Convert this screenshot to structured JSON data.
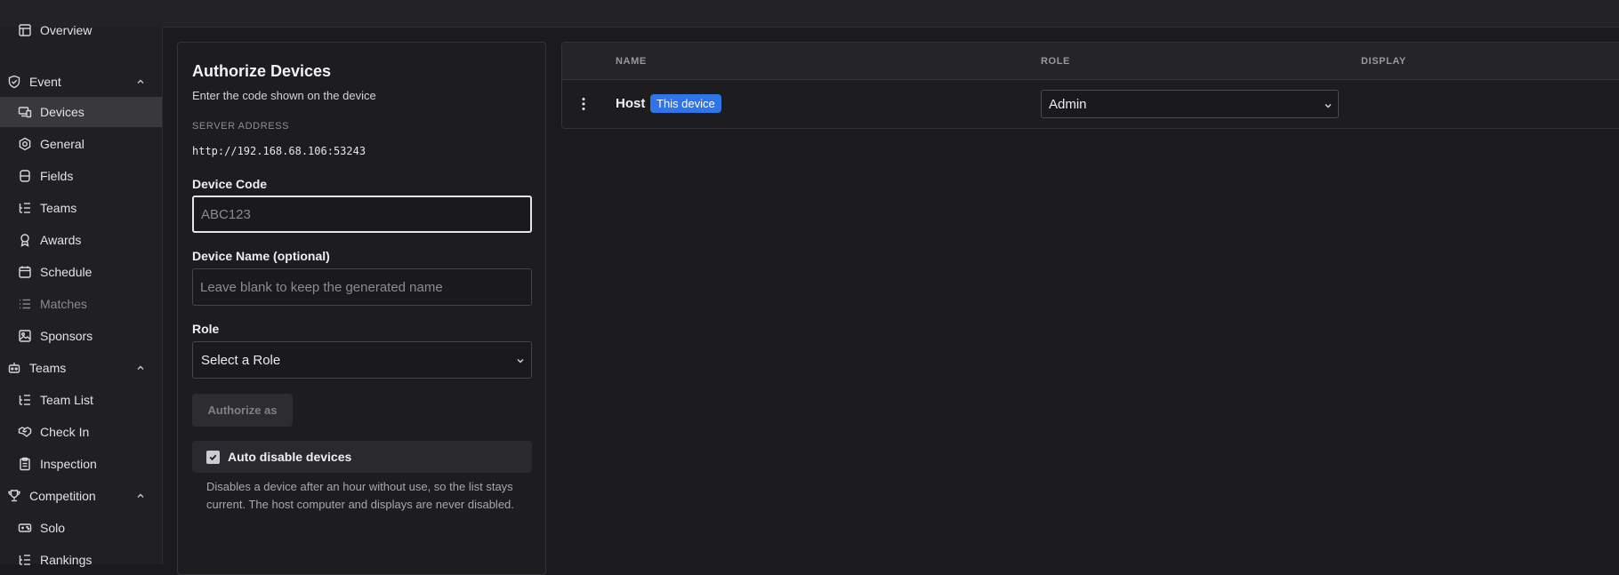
{
  "sidebar": {
    "items": [
      {
        "label": "Overview",
        "icon": "layout-icon"
      },
      {
        "label": "Event",
        "icon": "shield-check-icon",
        "expanded": true
      },
      {
        "label": "Devices",
        "icon": "devices-icon",
        "active": true
      },
      {
        "label": "General",
        "icon": "settings-hex-icon"
      },
      {
        "label": "Fields",
        "icon": "fields-icon"
      },
      {
        "label": "Teams",
        "icon": "list-tree-icon"
      },
      {
        "label": "Awards",
        "icon": "award-icon"
      },
      {
        "label": "Schedule",
        "icon": "calendar-icon"
      },
      {
        "label": "Matches",
        "icon": "list-icon",
        "disabled": true
      },
      {
        "label": "Sponsors",
        "icon": "image-icon"
      },
      {
        "label": "Teams",
        "icon": "robot-icon",
        "expanded": true
      },
      {
        "label": "Team List",
        "icon": "list-tree-icon"
      },
      {
        "label": "Check In",
        "icon": "handshake-icon"
      },
      {
        "label": "Inspection",
        "icon": "clipboard-icon"
      },
      {
        "label": "Competition",
        "icon": "trophy-icon",
        "expanded": true
      },
      {
        "label": "Solo",
        "icon": "gamepad-icon"
      },
      {
        "label": "Rankings",
        "icon": "list-tree-icon"
      }
    ]
  },
  "authorize": {
    "title": "Authorize Devices",
    "subtitle": "Enter the code shown on the device",
    "server_label": "SERVER ADDRESS",
    "server_address": "http://192.168.68.106:53243",
    "code_label": "Device Code",
    "code_placeholder": "ABC123",
    "name_label": "Device Name (optional)",
    "name_placeholder": "Leave blank to keep the generated name",
    "role_label": "Role",
    "role_value": "Select a Role",
    "button_label": "Authorize as",
    "auto_disable_label": "Auto disable devices",
    "auto_disable_checked": true,
    "auto_disable_help": "Disables a device after an hour without use, so the list stays current. The host computer and displays are never disabled."
  },
  "devices_table": {
    "headers": {
      "name": "NAME",
      "role": "ROLE",
      "display": "DISPLAY"
    },
    "rows": [
      {
        "name": "Host",
        "badge": "This device",
        "role": "Admin",
        "display": ""
      }
    ]
  },
  "colors": {
    "badge": "#2f74e8",
    "background": "#1b1b1e",
    "sidebar_active": "#38383d"
  }
}
